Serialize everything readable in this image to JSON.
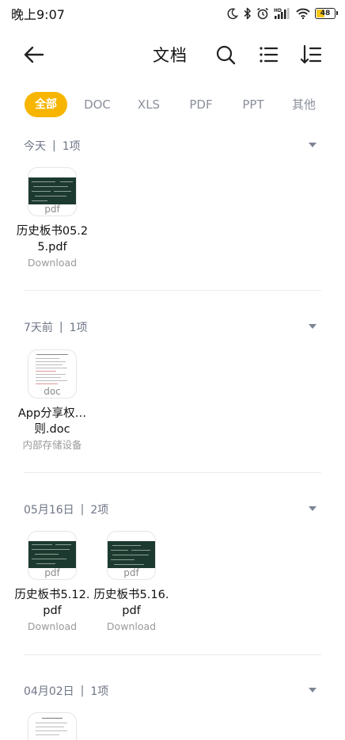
{
  "status_bar": {
    "time": "晚上9:07",
    "battery": 48,
    "battery_label": "48",
    "icons": [
      "moon-icon",
      "bluetooth-icon",
      "alarm-icon",
      "hd-signal-icon",
      "wifi-icon",
      "battery-icon"
    ]
  },
  "header": {
    "title": "文档",
    "icons": [
      "back-arrow-icon",
      "search-icon",
      "list-view-icon",
      "sort-icon"
    ]
  },
  "tabs": [
    {
      "label": "全部",
      "active": true
    },
    {
      "label": "DOC",
      "active": false
    },
    {
      "label": "XLS",
      "active": false
    },
    {
      "label": "PDF",
      "active": false
    },
    {
      "label": "PPT",
      "active": false
    },
    {
      "label": "其他",
      "active": false
    }
  ],
  "colors": {
    "accent": "#f7b500",
    "muted_text": "#8a8f9a",
    "divider": "#ececec"
  },
  "sections": [
    {
      "label": "今天",
      "sep": "|",
      "count": "1项",
      "files": [
        {
          "name": "历史板书05.25.pdf",
          "location": "Download",
          "ext": "pdf"
        }
      ]
    },
    {
      "label": "7天前",
      "sep": "|",
      "count": "1项",
      "files": [
        {
          "name": "App分享权…则.doc",
          "location": "内部存储设备",
          "ext": "doc"
        }
      ]
    },
    {
      "label": "05月16日",
      "sep": "|",
      "count": "2项",
      "files": [
        {
          "name": "历史板书5.12.pdf",
          "location": "Download",
          "ext": "pdf"
        },
        {
          "name": "历史板书5.16.pdf",
          "location": "Download",
          "ext": "pdf"
        }
      ]
    },
    {
      "label": "04月02日",
      "sep": "|",
      "count": "1项",
      "files": []
    }
  ]
}
